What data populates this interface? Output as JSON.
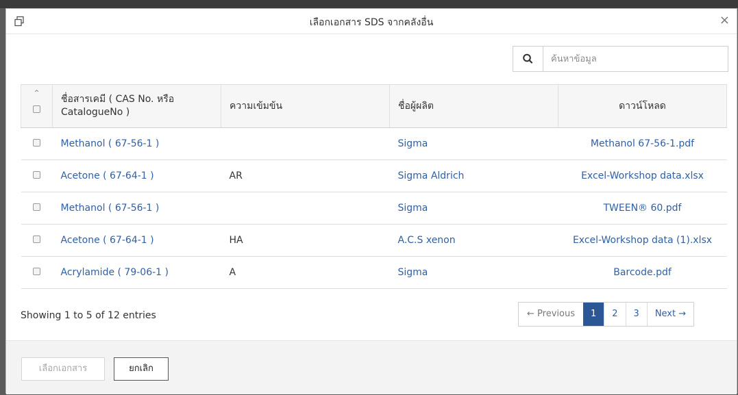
{
  "modal": {
    "title": "เลือกเอกสาร SDS จากคลังอื่น",
    "close_glyph": "×"
  },
  "search": {
    "placeholder": "ค้นหาข้อมูล",
    "value": "",
    "icon": "search-icon"
  },
  "table": {
    "sort_indicator": "^",
    "columns": [
      "ชื่อสารเคมี ( CAS No. หรือ CatalogueNo )",
      "ความเข้มข้น",
      "ชื่อผู้ผลิต",
      "ดาวน์โหลด"
    ],
    "rows": [
      {
        "chemical": "Methanol ( 67-56-1 )",
        "concentration": "",
        "manufacturer": "Sigma",
        "download": "Methanol 67-56-1.pdf"
      },
      {
        "chemical": "Acetone ( 67-64-1 )",
        "concentration": "AR",
        "manufacturer": "Sigma Aldrich",
        "download": "Excel-Workshop data.xlsx"
      },
      {
        "chemical": "Methanol ( 67-56-1 )",
        "concentration": "",
        "manufacturer": "Sigma",
        "download": "TWEEN® 60.pdf"
      },
      {
        "chemical": "Acetone ( 67-64-1 )",
        "concentration": "HA",
        "manufacturer": "A.C.S xenon",
        "download": "Excel-Workshop data (1).xlsx"
      },
      {
        "chemical": "Acrylamide ( 79-06-1 )",
        "concentration": "A",
        "manufacturer": "Sigma",
        "download": "Barcode.pdf"
      }
    ]
  },
  "pagination": {
    "info": "Showing 1 to 5 of 12 entries",
    "previous": "← Previous",
    "pages": [
      "1",
      "2",
      "3"
    ],
    "current_page": "1",
    "next": "Next →"
  },
  "footer": {
    "select_button": "เลือกเอกสาร",
    "cancel_button": "ยกเลิก"
  },
  "colors": {
    "link": "#2f5fa6",
    "active_page": "#2b5797",
    "header_bg": "#f6f6f6",
    "footer_bg": "#f3f3f3"
  }
}
